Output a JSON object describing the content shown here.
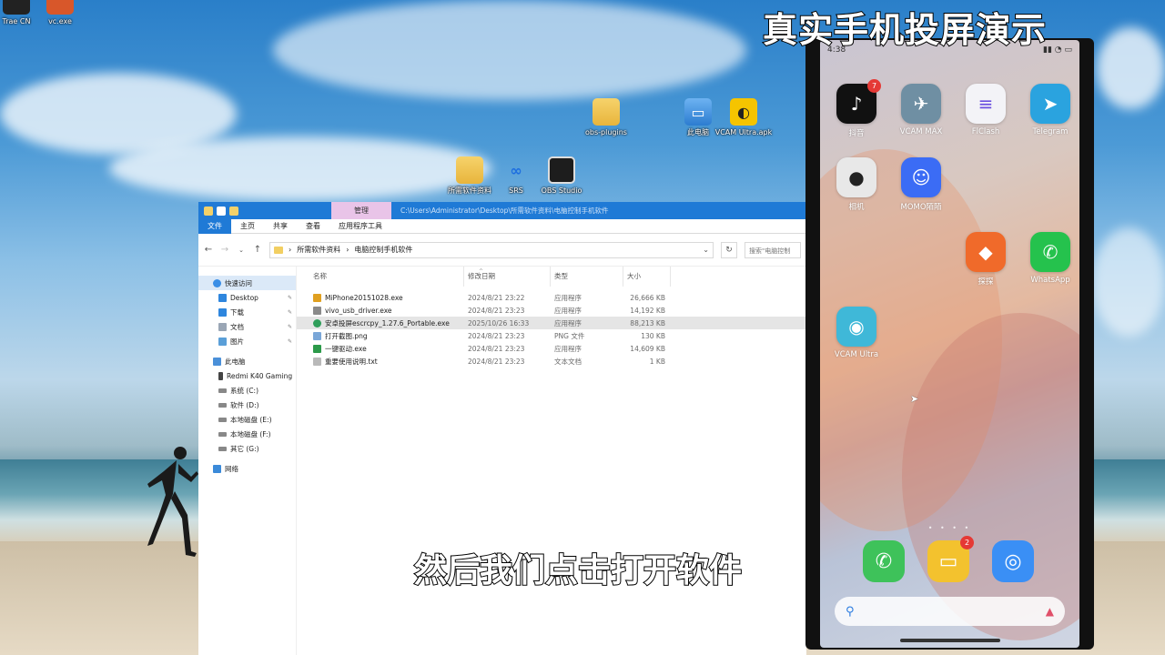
{
  "desktop": {
    "top_left_icons": [
      "Trae CN",
      "vc.exe"
    ],
    "icons": [
      {
        "label": "obs-plugins",
        "icon": "folder-icon"
      },
      {
        "label": "此电脑",
        "icon": "pc-icon"
      },
      {
        "label": "VCAM Ultra.apk",
        "icon": "vcam-icon"
      },
      {
        "label": "所需软件资料",
        "icon": "folder-icon"
      },
      {
        "label": "SRS",
        "icon": "srs-icon"
      },
      {
        "label": "OBS Studio",
        "icon": "obs-icon"
      }
    ]
  },
  "explorer": {
    "manage_tab": "管理",
    "title_path": "C:\\Users\\Administrator\\Desktop\\所需软件资料\\电脑控制手机软件",
    "ribbon_tabs": [
      "文件",
      "主页",
      "共享",
      "查看",
      "应用程序工具"
    ],
    "breadcrumb": [
      "所需软件资料",
      "电脑控制手机软件"
    ],
    "search_placeholder": "搜索\"电脑控制",
    "sidebar": [
      {
        "label": "快速访问",
        "type": "quick"
      },
      {
        "label": "Desktop",
        "type": "sub",
        "pinned": true
      },
      {
        "label": "下载",
        "type": "sub",
        "pinned": true
      },
      {
        "label": "文档",
        "type": "sub",
        "pinned": true
      },
      {
        "label": "图片",
        "type": "sub",
        "pinned": true
      },
      {
        "label": "此电脑",
        "type": "pc"
      },
      {
        "label": "Redmi K40 Gaming",
        "type": "sub"
      },
      {
        "label": "系统 (C:)",
        "type": "sub"
      },
      {
        "label": "软件 (D:)",
        "type": "sub"
      },
      {
        "label": "本地磁盘 (E:)",
        "type": "sub"
      },
      {
        "label": "本地磁盘 (F:)",
        "type": "sub"
      },
      {
        "label": "其它 (G:)",
        "type": "sub"
      },
      {
        "label": "网络",
        "type": "net"
      }
    ],
    "columns": {
      "name": "名称",
      "date": "修改日期",
      "type": "类型",
      "size": "大小"
    },
    "files": [
      {
        "name": "MiPhone20151028.exe",
        "date": "2024/8/21 23:22",
        "type": "应用程序",
        "size": "26,666 KB",
        "color": "#e0a020"
      },
      {
        "name": "vivo_usb_driver.exe",
        "date": "2024/8/21 23:23",
        "type": "应用程序",
        "size": "14,192 KB",
        "color": "#8a8a8a"
      },
      {
        "name": "安卓投屏escrcpy_1.27.6_Portable.exe",
        "date": "2025/10/26 16:33",
        "type": "应用程序",
        "size": "88,213 KB",
        "color": "#2f9e5a"
      },
      {
        "name": "打开截图.png",
        "date": "2024/8/21 23:23",
        "type": "PNG 文件",
        "size": "130 KB",
        "color": "#7aa7d8"
      },
      {
        "name": "一键驱动.exe",
        "date": "2024/8/21 23:23",
        "type": "应用程序",
        "size": "14,609 KB",
        "color": "#2c9a4a"
      },
      {
        "name": "重要使用说明.txt",
        "date": "2024/8/21 23:23",
        "type": "文本文档",
        "size": "1 KB",
        "color": "#b9b9b9"
      }
    ]
  },
  "phone": {
    "time": "4:38",
    "apps": [
      {
        "label": "抖音",
        "color": "#111111",
        "glyph": "♪",
        "badge": "7"
      },
      {
        "label": "VCAM MAX",
        "color": "#6f8fa3",
        "glyph": "✈",
        "badge": ""
      },
      {
        "label": "FlClash",
        "color": "#f3f3f7",
        "glyph": "≡",
        "badge": ""
      },
      {
        "label": "Telegram",
        "color": "#2aa3df",
        "glyph": "➤",
        "badge": ""
      },
      {
        "label": "相机",
        "color": "#e8e8e8",
        "glyph": "●",
        "badge": ""
      },
      {
        "label": "MOMO陌陌",
        "color": "#3b6cf5",
        "glyph": "☺",
        "badge": ""
      },
      {
        "label": "探探",
        "color": "#f06a2a",
        "glyph": "◆",
        "badge": ""
      },
      {
        "label": "WhatsApp",
        "color": "#25c24d",
        "glyph": "✆",
        "badge": ""
      },
      {
        "label": "VCAM Ultra",
        "color": "#3fb8d8",
        "glyph": "◉",
        "badge": ""
      }
    ],
    "dock": [
      {
        "name": "phone",
        "color": "#3ec25a",
        "glyph": "✆",
        "badge": ""
      },
      {
        "name": "notes",
        "color": "#f3c22e",
        "glyph": "▭",
        "badge": "2"
      },
      {
        "name": "browser",
        "color": "#3a8ff5",
        "glyph": "◎",
        "badge": ""
      }
    ]
  },
  "captions": {
    "top": "真实手机投屏演示",
    "bottom": "然后我们点击打开软件"
  }
}
